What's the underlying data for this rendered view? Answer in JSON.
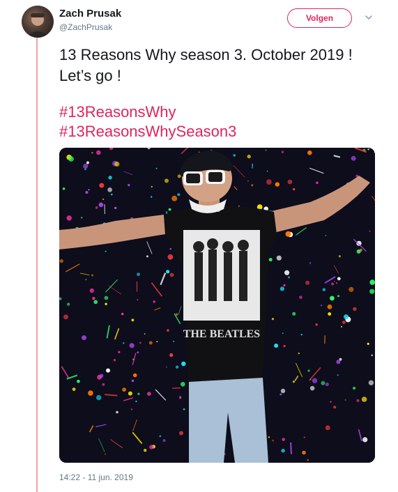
{
  "author": {
    "display_name": "Zach Prusak",
    "handle": "@ZachPrusak"
  },
  "follow_button": {
    "label": "Volgen"
  },
  "menu": {
    "icon": "chevron-down-icon"
  },
  "tweet": {
    "text": "13 Reasons Why season 3. October 2019 ! Let’s go !",
    "hashtags": [
      "#13ReasonsWhy",
      "#13ReasonsWhySeason3"
    ],
    "timestamp": "14:22 - 11 jun. 2019"
  },
  "media": {
    "shirt_text": "THE BEATLES"
  },
  "colors": {
    "accent": "#e0245e",
    "thread_line": "#f4a3a3",
    "secondary_text": "#657786",
    "primary_text": "#14171a"
  }
}
